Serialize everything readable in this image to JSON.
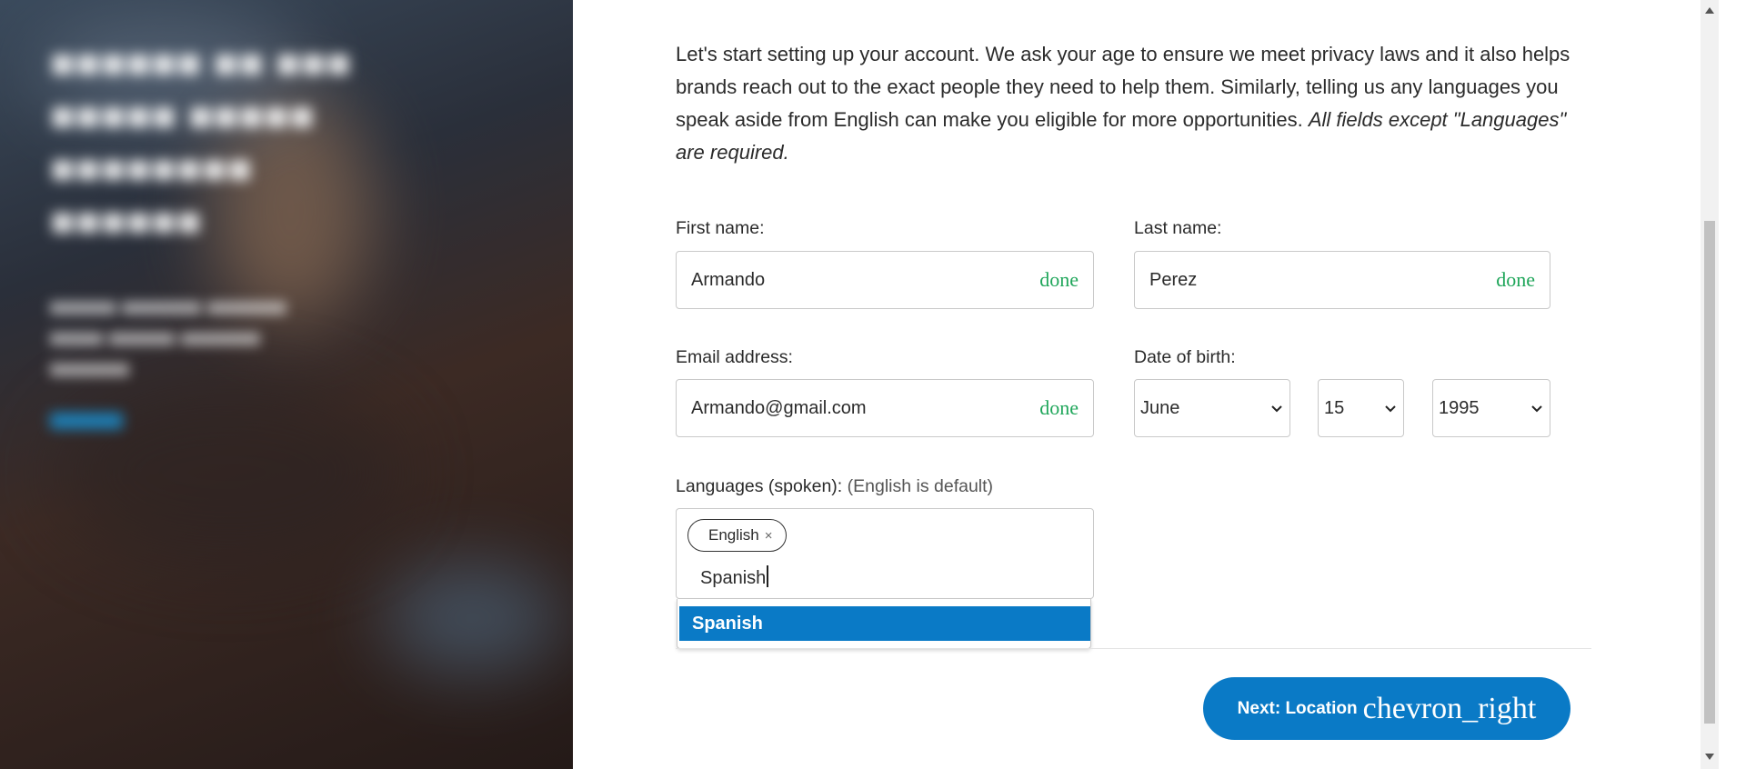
{
  "intro": {
    "text": "Let's start setting up your account. We ask your age to ensure we meet privacy laws and it also helps brands reach out to the exact people they need to help them. Similarly, telling us any languages you speak aside from English can make you eligible for more opportunities. ",
    "emphasis": "All fields except \"Languages\" are required."
  },
  "form": {
    "first_name": {
      "label": "First name:",
      "value": "Armando",
      "status": "done"
    },
    "last_name": {
      "label": "Last name:",
      "value": "Perez",
      "status": "done"
    },
    "email": {
      "label": "Email address:",
      "value": "Armando@gmail.com",
      "status": "done"
    },
    "dob": {
      "label": "Date of birth:",
      "month": "June",
      "day": "15",
      "year": "1995"
    },
    "languages": {
      "label": "Languages (spoken):",
      "hint": "(English is default)",
      "selected": [
        "English"
      ],
      "chip_remove": "×",
      "input_value": "Spanish",
      "suggestion": "Spanish"
    }
  },
  "next_button": {
    "label": "Next: Location",
    "icon": "chevron_right"
  },
  "colors": {
    "accent": "#0a7ac6",
    "done": "#1fa65a"
  }
}
